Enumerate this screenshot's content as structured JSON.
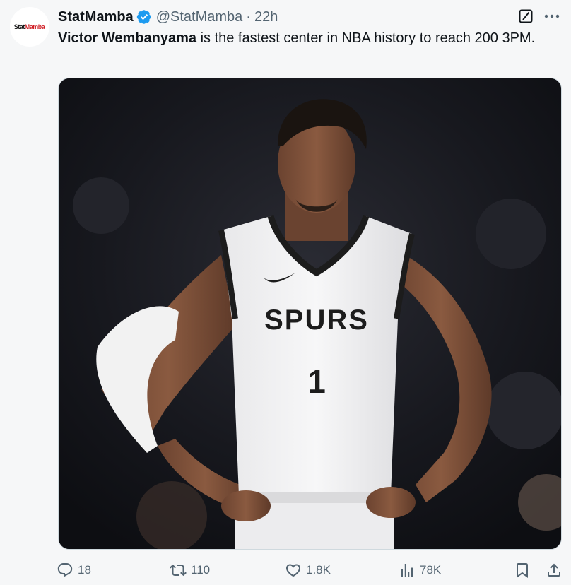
{
  "author": {
    "name": "StatMamba",
    "handle": "@StatMamba",
    "separator": "·",
    "time": "22h",
    "avatar_logo": {
      "part1": "Stat",
      "part2": "Mamba",
      "color_part1": "#111111",
      "color_part2": "#d01f26"
    },
    "verified_color": "#1d9bf0"
  },
  "tweet": {
    "bold_text": "Victor Wembanyama",
    "text": " is the fastest center in NBA history to reach 200 3PM."
  },
  "media": {
    "jersey_text": "SPURS",
    "jersey_number": "1"
  },
  "actions": {
    "reply": {
      "icon": "reply-icon",
      "count": "18"
    },
    "retweet": {
      "icon": "retweet-icon",
      "count": "110"
    },
    "like": {
      "icon": "heart-icon",
      "count": "1.8K"
    },
    "views": {
      "icon": "views-icon",
      "count": "78K"
    },
    "bookmark": {
      "icon": "bookmark-icon"
    },
    "share": {
      "icon": "share-icon"
    }
  },
  "header_icons": {
    "grok": "grok-icon",
    "more": "more-icon"
  },
  "colors": {
    "text_primary": "#0f1419",
    "text_secondary": "#536471",
    "background": "#f6f7f8"
  }
}
